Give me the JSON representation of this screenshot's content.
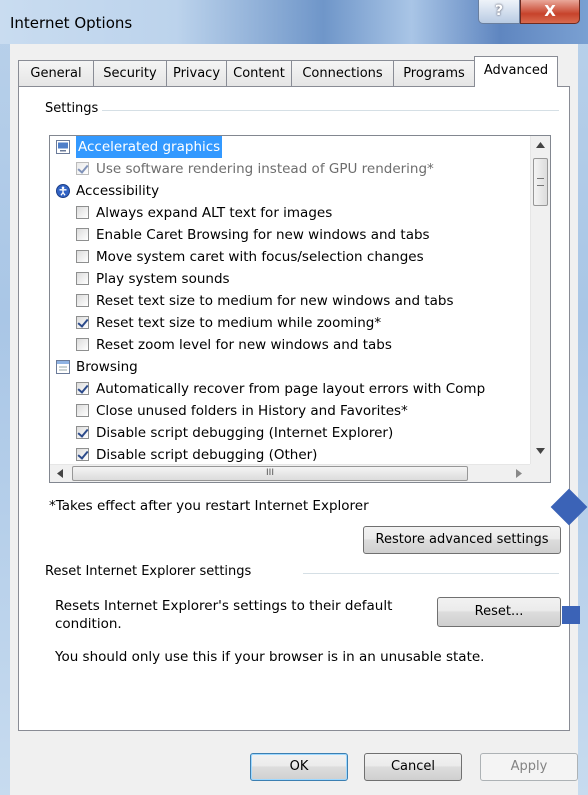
{
  "window": {
    "title": "Internet Options",
    "help_glyph": "?",
    "close_glyph": "X"
  },
  "tabs": [
    {
      "label": "General"
    },
    {
      "label": "Security"
    },
    {
      "label": "Privacy"
    },
    {
      "label": "Content"
    },
    {
      "label": "Connections"
    },
    {
      "label": "Programs"
    },
    {
      "label": "Advanced",
      "active": true
    }
  ],
  "settings": {
    "group_label": "Settings",
    "items": [
      {
        "type": "category",
        "icon": "monitor-icon",
        "label": "Accelerated graphics",
        "selected": true
      },
      {
        "type": "checkbox",
        "checked": true,
        "disabled": true,
        "label": "Use software rendering instead of GPU rendering*"
      },
      {
        "type": "category",
        "icon": "accessibility-icon",
        "label": "Accessibility"
      },
      {
        "type": "checkbox",
        "checked": false,
        "label": "Always expand ALT text for images"
      },
      {
        "type": "checkbox",
        "checked": false,
        "label": "Enable Caret Browsing for new windows and tabs"
      },
      {
        "type": "checkbox",
        "checked": false,
        "label": "Move system caret with focus/selection changes"
      },
      {
        "type": "checkbox",
        "checked": false,
        "label": "Play system sounds"
      },
      {
        "type": "checkbox",
        "checked": false,
        "label": "Reset text size to medium for new windows and tabs"
      },
      {
        "type": "checkbox",
        "checked": true,
        "label": "Reset text size to medium while zooming*"
      },
      {
        "type": "checkbox",
        "checked": false,
        "label": "Reset zoom level for new windows and tabs"
      },
      {
        "type": "category",
        "icon": "browsing-icon",
        "label": "Browsing"
      },
      {
        "type": "checkbox",
        "checked": true,
        "label": "Automatically recover from page layout errors with Comp"
      },
      {
        "type": "checkbox",
        "checked": false,
        "label": "Close unused folders in History and Favorites*"
      },
      {
        "type": "checkbox",
        "checked": true,
        "label": "Disable script debugging (Internet Explorer)"
      },
      {
        "type": "checkbox",
        "checked": true,
        "label": "Disable script debugging (Other)"
      }
    ],
    "hscroll_grip": "III",
    "restart_note": "*Takes effect after you restart Internet Explorer",
    "restore_button": "Restore advanced settings"
  },
  "reset": {
    "group_label": "Reset Internet Explorer settings",
    "description": "Resets Internet Explorer's settings to their default condition.",
    "button": "Reset...",
    "warning": "You should only use this if your browser is in an unusable state."
  },
  "footer": {
    "ok": "OK",
    "cancel": "Cancel",
    "apply": "Apply"
  }
}
